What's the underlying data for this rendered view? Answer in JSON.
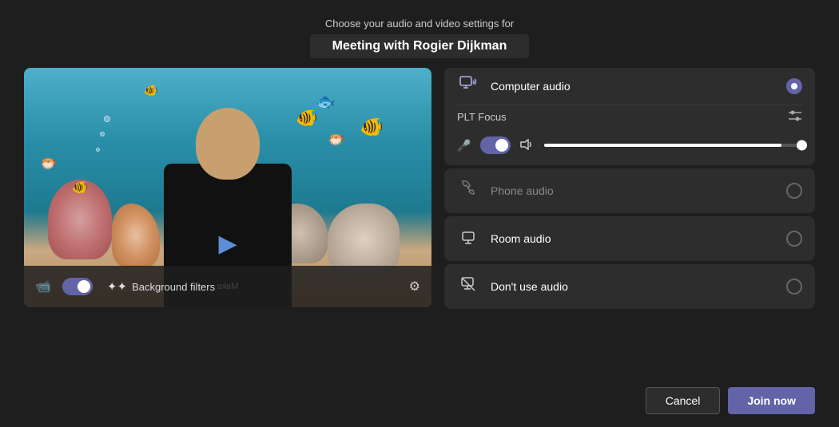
{
  "header": {
    "subtitle": "Choose your audio and video settings for",
    "title": "Meeting with Rogier Dijkman"
  },
  "video_panel": {
    "background_filters_label": "Background filters"
  },
  "audio_options": {
    "computer_audio": {
      "label": "Computer audio",
      "checked": true,
      "plt_focus": {
        "label": "PLT Focus"
      }
    },
    "phone_audio": {
      "label": "Phone audio",
      "checked": false
    },
    "room_audio": {
      "label": "Room audio",
      "checked": false
    },
    "no_audio": {
      "label": "Don't use audio",
      "checked": false
    }
  },
  "footer": {
    "cancel_label": "Cancel",
    "join_label": "Join now"
  },
  "icons": {
    "computer_audio": "🖥",
    "phone_audio": "📞",
    "room_audio": "🔔",
    "no_audio": "🔇",
    "mic": "🎤",
    "speaker": "🔊",
    "camera": "📹",
    "background_filter": "✦",
    "settings": "⚙",
    "sliders": "⚙"
  }
}
